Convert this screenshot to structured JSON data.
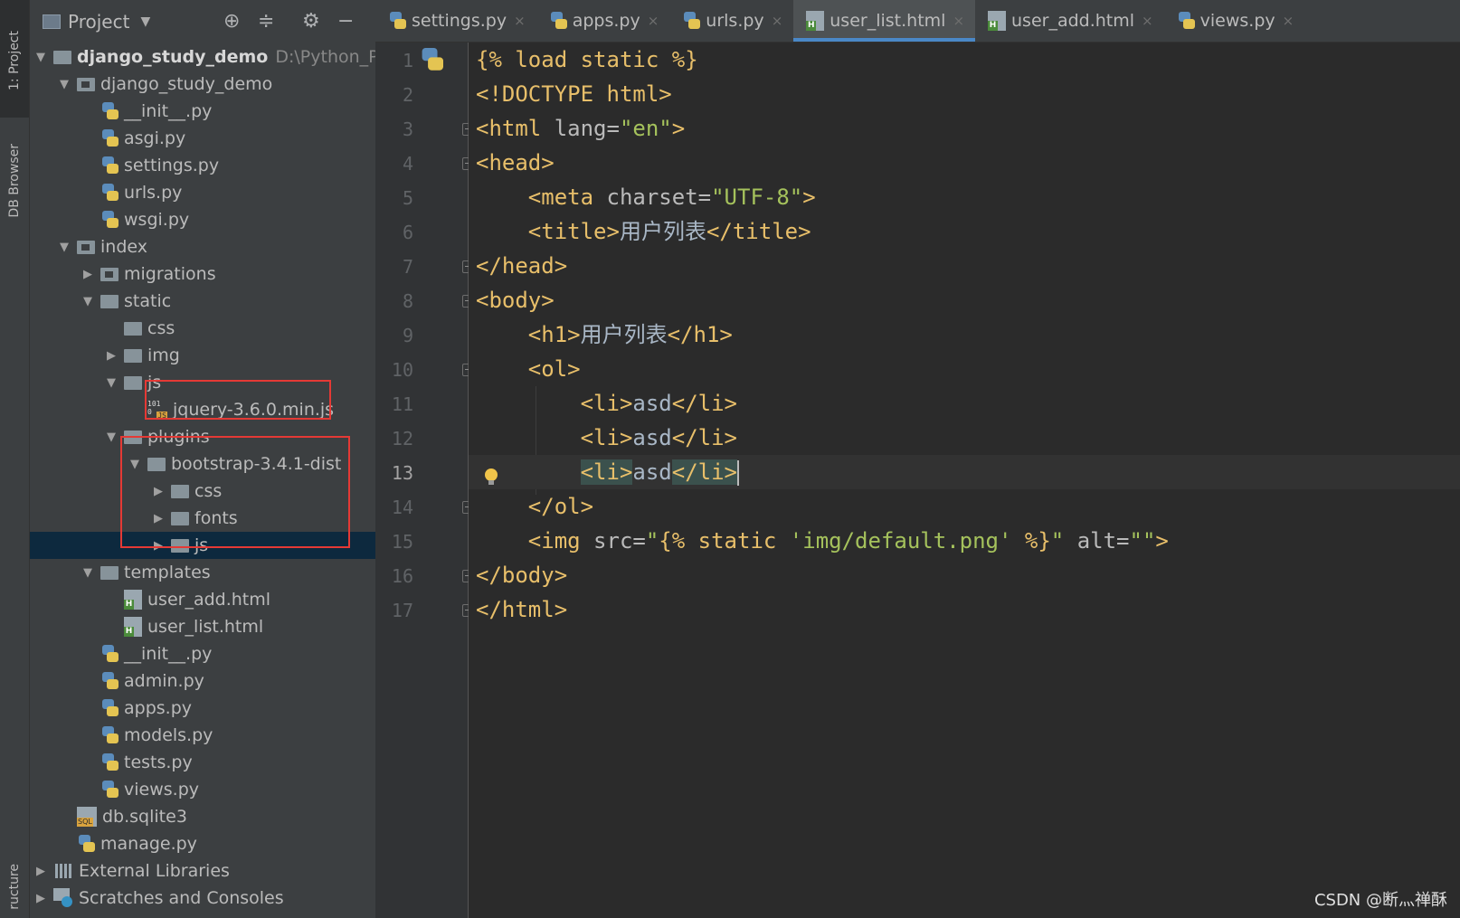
{
  "side_stripe": {
    "project_tool": "1: Project",
    "db_browser_tool": "DB Browser",
    "structure_tool": "ructure"
  },
  "project_panel": {
    "title": "Project",
    "tree": [
      {
        "label": "django_study_demo",
        "path": "D:\\Python_Proje",
        "icon": "folder-icon",
        "depth": 0,
        "arrow": "down",
        "bold": true
      },
      {
        "label": "django_study_demo",
        "icon": "package-folder-icon",
        "depth": 1,
        "arrow": "down"
      },
      {
        "label": "__init__.py",
        "icon": "python-file-icon",
        "depth": 2
      },
      {
        "label": "asgi.py",
        "icon": "python-file-icon",
        "depth": 2
      },
      {
        "label": "settings.py",
        "icon": "python-file-icon",
        "depth": 2
      },
      {
        "label": "urls.py",
        "icon": "python-file-icon",
        "depth": 2
      },
      {
        "label": "wsgi.py",
        "icon": "python-file-icon",
        "depth": 2
      },
      {
        "label": "index",
        "icon": "package-folder-icon",
        "depth": 1,
        "arrow": "down"
      },
      {
        "label": "migrations",
        "icon": "package-folder-icon",
        "depth": 2,
        "arrow": "right"
      },
      {
        "label": "static",
        "icon": "folder-icon",
        "depth": 2,
        "arrow": "down"
      },
      {
        "label": "css",
        "icon": "folder-icon",
        "depth": 3
      },
      {
        "label": "img",
        "icon": "folder-icon",
        "depth": 3,
        "arrow": "right"
      },
      {
        "label": "js",
        "icon": "folder-icon",
        "depth": 3,
        "arrow": "down"
      },
      {
        "label": "jquery-3.6.0.min.js",
        "icon": "js-file-icon",
        "depth": 4
      },
      {
        "label": "plugins",
        "icon": "folder-icon",
        "depth": 3,
        "arrow": "down"
      },
      {
        "label": "bootstrap-3.4.1-dist",
        "icon": "folder-icon",
        "depth": 4,
        "arrow": "down"
      },
      {
        "label": "css",
        "icon": "folder-icon",
        "depth": 5,
        "arrow": "right"
      },
      {
        "label": "fonts",
        "icon": "folder-icon",
        "depth": 5,
        "arrow": "right"
      },
      {
        "label": "js",
        "icon": "folder-icon",
        "depth": 5,
        "arrow": "right",
        "selected": true
      },
      {
        "label": "templates",
        "icon": "folder-icon",
        "depth": 2,
        "arrow": "down"
      },
      {
        "label": "user_add.html",
        "icon": "html-file-icon",
        "depth": 3
      },
      {
        "label": "user_list.html",
        "icon": "html-file-icon",
        "depth": 3
      },
      {
        "label": "__init__.py",
        "icon": "python-file-icon",
        "depth": 2
      },
      {
        "label": "admin.py",
        "icon": "python-file-icon",
        "depth": 2
      },
      {
        "label": "apps.py",
        "icon": "python-file-icon",
        "depth": 2
      },
      {
        "label": "models.py",
        "icon": "python-file-icon",
        "depth": 2
      },
      {
        "label": "tests.py",
        "icon": "python-file-icon",
        "depth": 2
      },
      {
        "label": "views.py",
        "icon": "python-file-icon",
        "depth": 2
      },
      {
        "label": "db.sqlite3",
        "icon": "sqlite-file-icon",
        "depth": 1
      },
      {
        "label": "manage.py",
        "icon": "python-file-icon",
        "depth": 1
      },
      {
        "label": "External Libraries",
        "icon": "libraries-icon",
        "depth": 0,
        "arrow": "right"
      },
      {
        "label": "Scratches and Consoles",
        "icon": "scratches-icon",
        "depth": 0,
        "arrow": "right"
      }
    ]
  },
  "tabs": [
    {
      "label": "settings.py",
      "icon": "python-file-icon"
    },
    {
      "label": "apps.py",
      "icon": "python-file-icon"
    },
    {
      "label": "urls.py",
      "icon": "python-file-icon"
    },
    {
      "label": "user_list.html",
      "icon": "html-file-icon",
      "active": true
    },
    {
      "label": "user_add.html",
      "icon": "html-file-icon"
    },
    {
      "label": "views.py",
      "icon": "python-file-icon"
    }
  ],
  "editor": {
    "current_line": 13,
    "lines": [
      [
        {
          "c": "tp",
          "t": "{% load static %}"
        }
      ],
      [
        {
          "c": "t",
          "t": "<!DOCTYPE html>"
        }
      ],
      [
        {
          "c": "t",
          "t": "<html "
        },
        {
          "c": "a",
          "t": "lang="
        },
        {
          "c": "v",
          "t": "\"en\""
        },
        {
          "c": "t",
          "t": ">"
        }
      ],
      [
        {
          "c": "t",
          "t": "<head>"
        }
      ],
      [
        {
          "c": "t",
          "t": "    <meta "
        },
        {
          "c": "a",
          "t": "charset="
        },
        {
          "c": "v",
          "t": "\"UTF-8\""
        },
        {
          "c": "t",
          "t": ">"
        }
      ],
      [
        {
          "c": "t",
          "t": "    <title>"
        },
        {
          "c": "tx",
          "t": "用户列表"
        },
        {
          "c": "t",
          "t": "</title>"
        }
      ],
      [
        {
          "c": "t",
          "t": "</head>"
        }
      ],
      [
        {
          "c": "t",
          "t": "<body>"
        }
      ],
      [
        {
          "c": "t",
          "t": "    <h1>"
        },
        {
          "c": "tx",
          "t": "用户列表"
        },
        {
          "c": "t",
          "t": "</h1>"
        }
      ],
      [
        {
          "c": "t",
          "t": "    <ol>"
        }
      ],
      [
        {
          "c": "t",
          "t": "        <li>"
        },
        {
          "c": "tx",
          "t": "asd"
        },
        {
          "c": "t",
          "t": "</li>"
        }
      ],
      [
        {
          "c": "t",
          "t": "        <li>"
        },
        {
          "c": "tx",
          "t": "asd"
        },
        {
          "c": "t",
          "t": "</li>"
        }
      ],
      [
        {
          "c": "t",
          "t": "        "
        },
        {
          "c": "t hl",
          "t": "<li>"
        },
        {
          "c": "tx",
          "t": "asd"
        },
        {
          "c": "t hl",
          "t": "</li>"
        },
        {
          "c": "caret",
          "t": ""
        }
      ],
      [
        {
          "c": "t",
          "t": "    </ol>"
        }
      ],
      [
        {
          "c": "t",
          "t": "    <img "
        },
        {
          "c": "a",
          "t": "src="
        },
        {
          "c": "v",
          "t": "\""
        },
        {
          "c": "tp",
          "t": "{% static "
        },
        {
          "c": "v",
          "t": "'img/default.png'"
        },
        {
          "c": "tp",
          "t": " %}"
        },
        {
          "c": "v",
          "t": "\""
        },
        {
          "c": "a",
          "t": " alt="
        },
        {
          "c": "v",
          "t": "\"\""
        },
        {
          "c": "t",
          "t": ">"
        }
      ],
      [
        {
          "c": "t",
          "t": "</body>"
        }
      ],
      [
        {
          "c": "t",
          "t": "</html>"
        }
      ]
    ]
  },
  "watermark": "CSDN @断灬禅酥",
  "colors": {
    "accent": "#4a88c7",
    "highlight_box": "#e53935",
    "selection": "#0d293e"
  }
}
